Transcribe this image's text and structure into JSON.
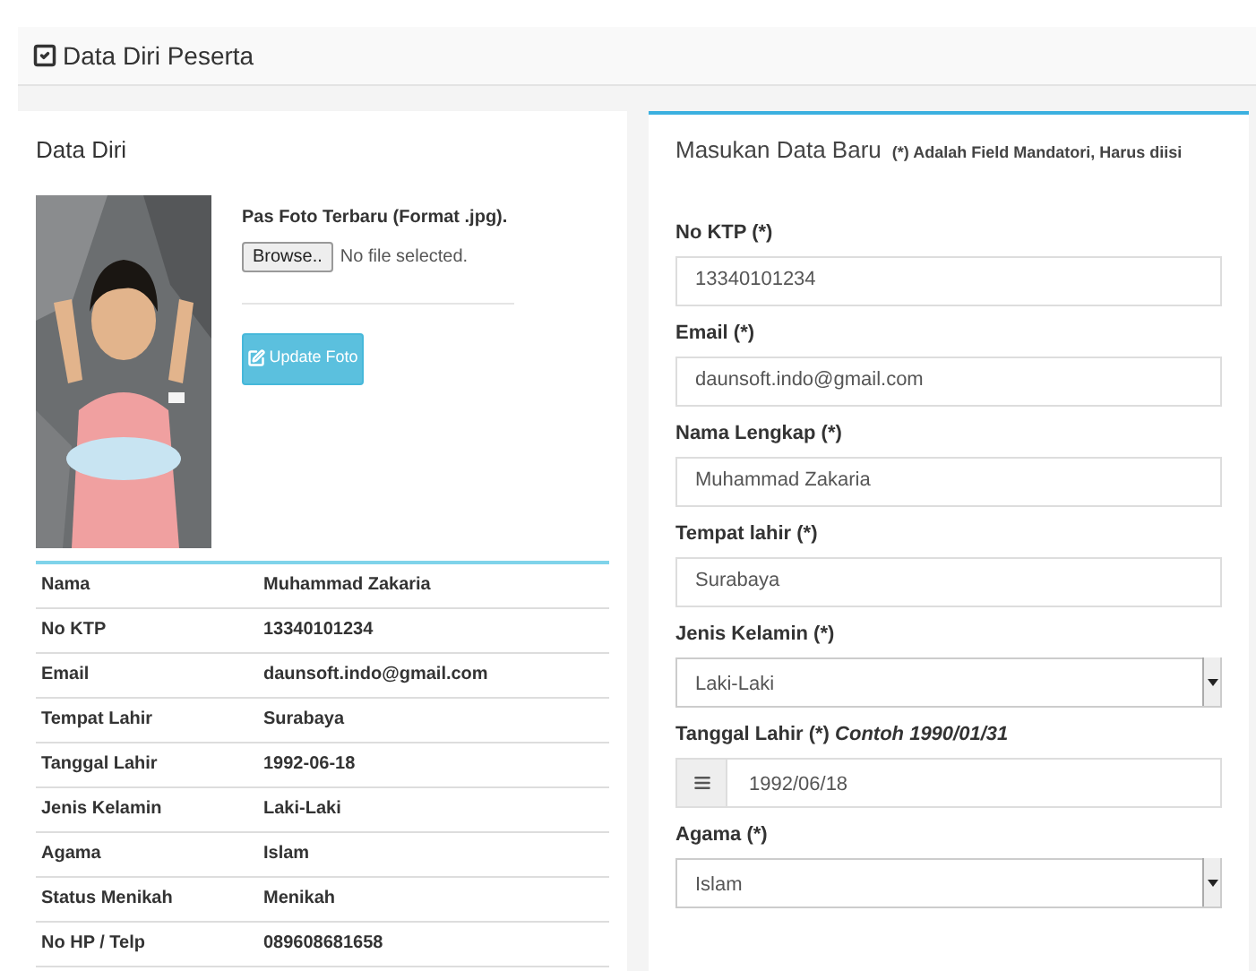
{
  "page_title": "Data Diri Peserta",
  "profile": {
    "title": "Data Diri",
    "upload_label": "Pas Foto Terbaru (Format .jpg).",
    "browse_button": "Browse..",
    "file_status": "No file selected.",
    "update_button": "Update Foto",
    "details": [
      {
        "label": "Nama",
        "value": "Muhammad Zakaria"
      },
      {
        "label": "No KTP",
        "value": "13340101234"
      },
      {
        "label": "Email",
        "value": "daunsoft.indo@gmail.com"
      },
      {
        "label": "Tempat Lahir",
        "value": "Surabaya"
      },
      {
        "label": "Tanggal Lahir",
        "value": "1992-06-18"
      },
      {
        "label": "Jenis Kelamin",
        "value": "Laki-Laki"
      },
      {
        "label": "Agama",
        "value": "Islam"
      },
      {
        "label": "Status Menikah",
        "value": "Menikah"
      },
      {
        "label": "No HP / Telp",
        "value": "089608681658"
      }
    ]
  },
  "form": {
    "title": "Masukan Data Baru",
    "note": "(*) Adalah Field Mandatori, Harus diisi",
    "fields": [
      {
        "kind": "text",
        "label": "No KTP (*)",
        "value": "13340101234"
      },
      {
        "kind": "text",
        "label": "Email (*)",
        "value": "daunsoft.indo@gmail.com"
      },
      {
        "kind": "text",
        "label": "Nama Lengkap (*)",
        "value": "Muhammad Zakaria"
      },
      {
        "kind": "text",
        "label": "Tempat lahir (*)",
        "value": "Surabaya"
      },
      {
        "kind": "select",
        "label": "Jenis Kelamin (*)",
        "value": "Laki-Laki"
      },
      {
        "kind": "date",
        "label": "Tanggal Lahir (*) *Contoh 1990/01/31*",
        "value": "1992/06/18"
      },
      {
        "kind": "select",
        "label": "Agama (*)",
        "value": "Islam"
      }
    ]
  }
}
